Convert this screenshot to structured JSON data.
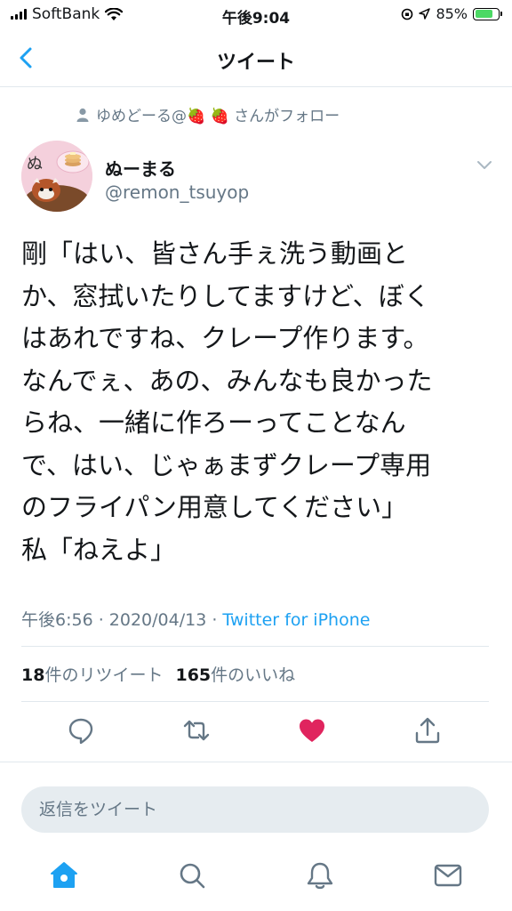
{
  "status_bar": {
    "carrier": "SoftBank",
    "time": "午後9:04",
    "battery_percent": "85%",
    "battery_level": 0.85,
    "icons": [
      "signal-icon",
      "wifi-icon",
      "orientation-lock-icon",
      "location-icon",
      "battery-icon"
    ]
  },
  "header": {
    "title": "ツイート",
    "back_icon": "back-chevron-icon"
  },
  "social_context": {
    "icon": "person-icon",
    "text": "ゆめどーる@🍓 🍓 さんがフォロー"
  },
  "author": {
    "display_name": "ぬーまる",
    "username": "@remon_tsuyop"
  },
  "tweet": {
    "lines": [
      "剛「はい、皆さん手ぇ洗う動画と",
      "か、窓拭いたりしてますけど、ぼく",
      "はあれですね、クレープ作ります。",
      "なんでぇ、あの、みんなも良かった",
      "らね、一緒に作ろーってことなん",
      "で、はい、じゃぁまずクレープ専用",
      "のフライパン用意してください」",
      "私「ねえよ」"
    ],
    "timestamp": "午後6:56 · 2020/04/13 · ",
    "source": "Twitter for iPhone"
  },
  "stats": {
    "retweets_count": "18",
    "retweets_label": "件のリツイート",
    "likes_count": "165",
    "likes_label": "件のいいね"
  },
  "actions": {
    "icons": [
      "reply-icon",
      "retweet-icon",
      "like-icon",
      "share-icon"
    ],
    "liked": true
  },
  "reply": {
    "placeholder": "返信をツイート"
  },
  "tabbar": {
    "icons": [
      "home-icon",
      "search-icon",
      "notifications-icon",
      "messages-icon"
    ],
    "active": "home-icon"
  },
  "colors": {
    "accent": "#1da1f2",
    "like": "#e0245e",
    "secondary_text": "#657786",
    "battery_fill": "#4cd964"
  }
}
